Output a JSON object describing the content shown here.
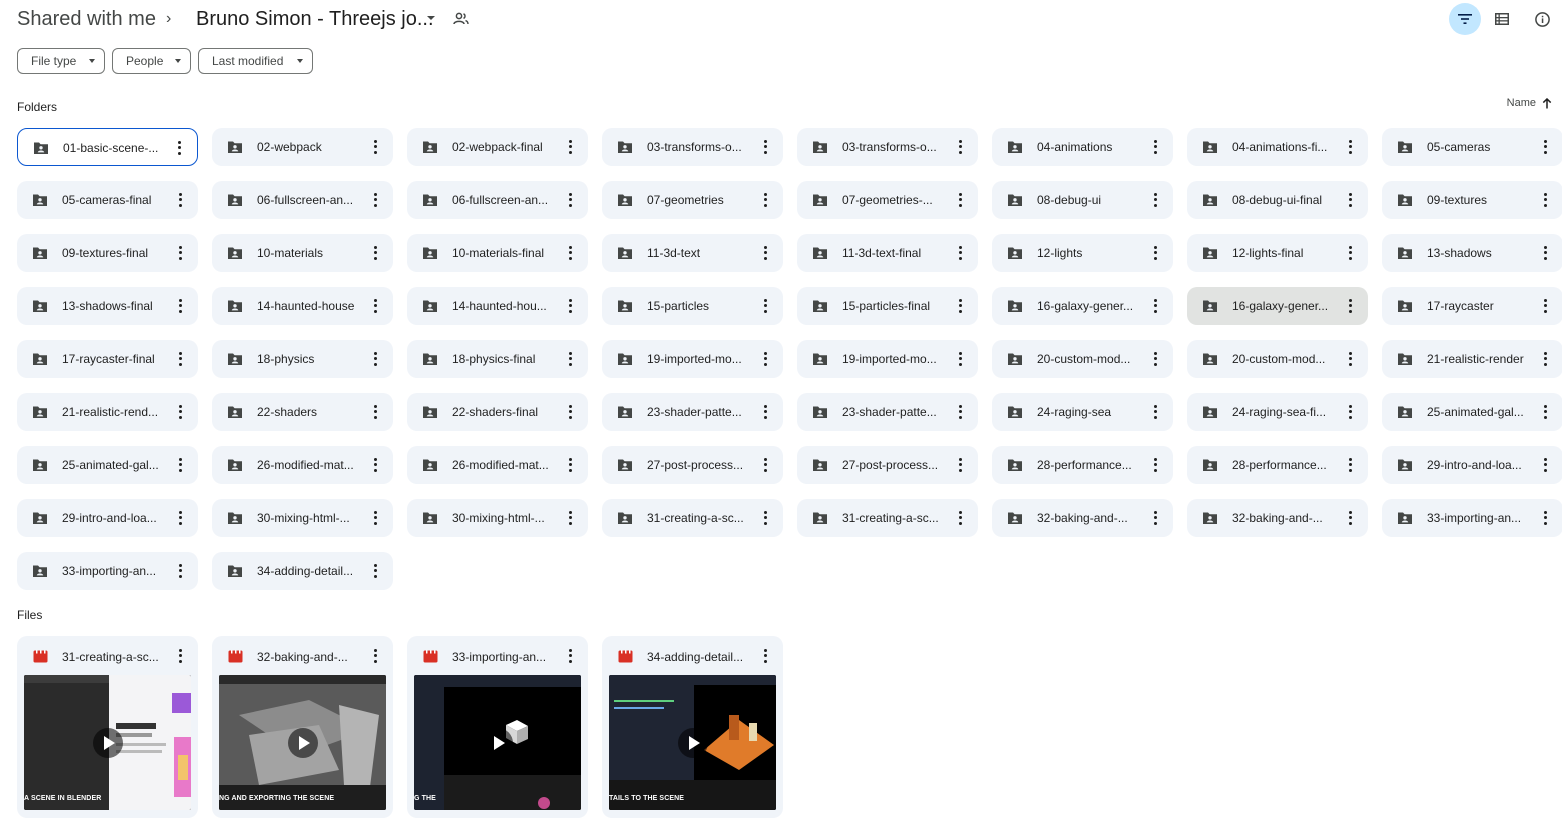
{
  "breadcrumb": {
    "root": "Shared with me",
    "separator": "›",
    "current": "Bruno Simon - Threejs jo..."
  },
  "header_icons": [
    "filter-icon",
    "list-view-icon",
    "info-icon"
  ],
  "filters": [
    {
      "label": "File type"
    },
    {
      "label": "People"
    },
    {
      "label": "Last modified"
    }
  ],
  "sections": {
    "folders": "Folders",
    "files": "Files"
  },
  "sort": {
    "label": "Name",
    "direction": "ascending"
  },
  "folders": [
    "01-basic-scene-...",
    "02-webpack",
    "02-webpack-final",
    "03-transforms-o...",
    "03-transforms-o...",
    "04-animations",
    "04-animations-fi...",
    "05-cameras",
    "05-cameras-final",
    "06-fullscreen-an...",
    "06-fullscreen-an...",
    "07-geometries",
    "07-geometries-...",
    "08-debug-ui",
    "08-debug-ui-final",
    "09-textures",
    "09-textures-final",
    "10-materials",
    "10-materials-final",
    "11-3d-text",
    "11-3d-text-final",
    "12-lights",
    "12-lights-final",
    "13-shadows",
    "13-shadows-final",
    "14-haunted-house",
    "14-haunted-hou...",
    "15-particles",
    "15-particles-final",
    "16-galaxy-gener...",
    "16-galaxy-gener...",
    "17-raycaster",
    "17-raycaster-final",
    "18-physics",
    "18-physics-final",
    "19-imported-mo...",
    "19-imported-mo...",
    "20-custom-mod...",
    "20-custom-mod...",
    "21-realistic-render",
    "21-realistic-rend...",
    "22-shaders",
    "22-shaders-final",
    "23-shader-patte...",
    "23-shader-patte...",
    "24-raging-sea",
    "24-raging-sea-fi...",
    "25-animated-gal...",
    "25-animated-gal...",
    "26-modified-mat...",
    "26-modified-mat...",
    "27-post-process...",
    "27-post-process...",
    "28-performance...",
    "28-performance...",
    "29-intro-and-loa...",
    "29-intro-and-loa...",
    "30-mixing-html-...",
    "30-mixing-html-...",
    "31-creating-a-sc...",
    "31-creating-a-sc...",
    "32-baking-and-...",
    "32-baking-and-...",
    "33-importing-an...",
    "33-importing-an...",
    "34-adding-detail..."
  ],
  "selected_folder_index": 0,
  "hovered_folder_index": 30,
  "files": [
    {
      "name": "31-creating-a-sc...",
      "caption": "A SCENE IN BLENDER",
      "thumb": "blender-browser"
    },
    {
      "name": "32-baking-and-...",
      "caption": "NG AND EXPORTING THE SCENE",
      "thumb": "gray-scene"
    },
    {
      "name": "33-importing-an...",
      "caption": "G THE",
      "thumb": "white-cube"
    },
    {
      "name": "34-adding-detail...",
      "caption": "TAILS TO THE SCENE",
      "thumb": "orange-scene"
    }
  ],
  "colors": {
    "accent": "#0b57d0",
    "card_bg": "#f0f4f9",
    "active_button_bg": "#c2e7ff",
    "video_icon": "#d93025",
    "folder_icon": "#444746"
  }
}
